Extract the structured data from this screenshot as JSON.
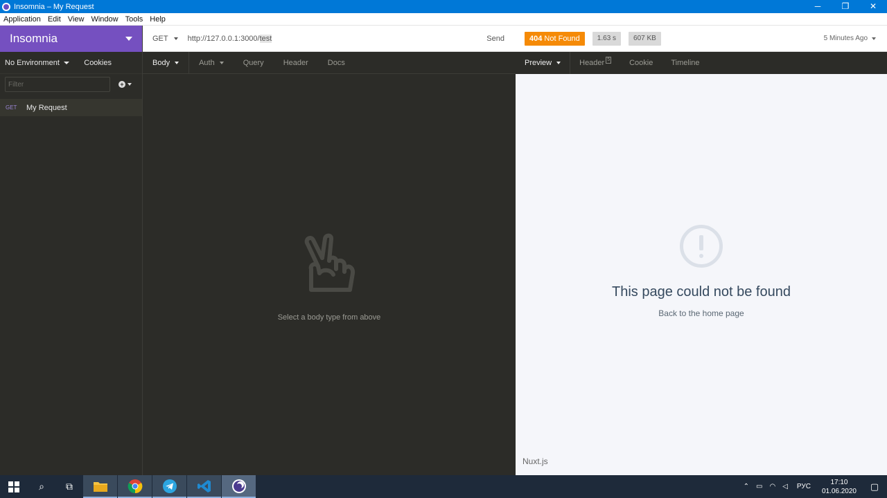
{
  "window": {
    "title": "Insomnia – My Request",
    "minimize_glyph": "─",
    "restore_glyph": "❐",
    "close_glyph": "✕"
  },
  "menu": {
    "items": [
      "Application",
      "Edit",
      "View",
      "Window",
      "Tools",
      "Help"
    ]
  },
  "sidebar": {
    "workspace": "Insomnia",
    "environment": "No Environment",
    "cookies": "Cookies",
    "filter_placeholder": "Filter",
    "plus_glyph": "+",
    "requests": [
      {
        "method": "GET",
        "name": "My Request"
      }
    ]
  },
  "request": {
    "method": "GET",
    "url_base": "http://127.0.0.1:3000/",
    "url_path": "test",
    "send_label": "Send",
    "tabs": [
      "Body",
      "Auth",
      "Query",
      "Header",
      "Docs"
    ],
    "empty_hint": "Select a body type from above"
  },
  "response": {
    "status_code": "404",
    "status_text": "Not Found",
    "time": "1.63 s",
    "size": "607 KB",
    "time_ago": "5 Minutes Ago",
    "tabs": {
      "preview": "Preview",
      "header": "Header",
      "header_count": "5",
      "cookie": "Cookie",
      "timeline": "Timeline"
    },
    "preview": {
      "title": "This page could not be found",
      "link": "Back to the home page",
      "footer": "Nuxt.js"
    }
  },
  "taskbar": {
    "lang": "РУС",
    "time": "17:10",
    "date": "01.06.2020",
    "search_glyph": "⌕",
    "taskview_glyph": "⧉",
    "tray_up_glyph": "⌃",
    "battery_glyph": "▭",
    "wifi_glyph": "◠",
    "volume_glyph": "◁",
    "notification_glyph": "▢"
  },
  "colors": {
    "accent": "#7550c0",
    "status_error": "#f58a07",
    "titlebar": "#0078d7"
  }
}
